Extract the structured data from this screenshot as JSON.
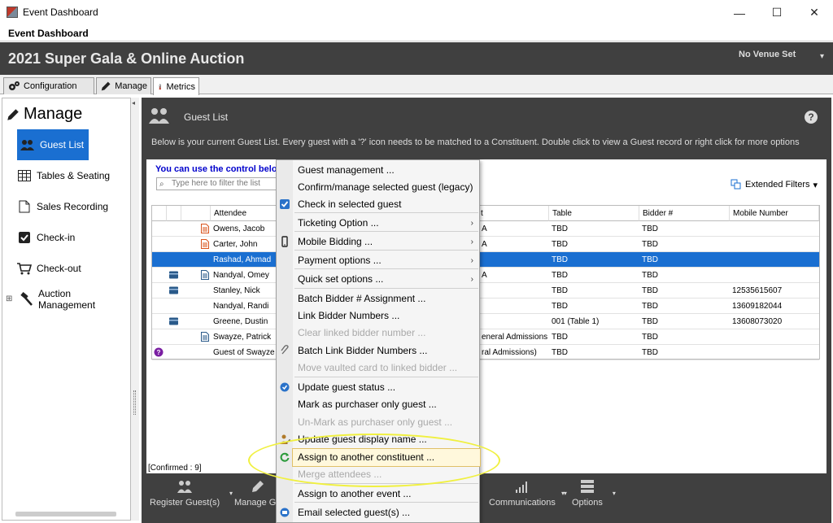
{
  "window": {
    "title": "Event Dashboard",
    "minimize": "—",
    "maximize": "☐",
    "close": "✕"
  },
  "app_header": "Event Dashboard",
  "banner": {
    "event_title": "2021 Super Gala & Online Auction",
    "venue": "No Venue Set"
  },
  "tabs": [
    {
      "label": "Configuration"
    },
    {
      "label": "Manage"
    },
    {
      "label": "Metrics"
    }
  ],
  "sidebar": {
    "heading": "Manage",
    "items": [
      {
        "label": "Guest List"
      },
      {
        "label": "Tables & Seating"
      },
      {
        "label": "Sales Recording"
      },
      {
        "label": "Check-in"
      },
      {
        "label": "Check-out"
      },
      {
        "label": "Auction Management"
      }
    ],
    "expand": "⊞"
  },
  "main": {
    "title": "Guest List",
    "help": "?",
    "description": "Below is your current Guest List. Every guest with a '?' icon needs to be matched to a Constituent. Double click to view a Guest record or right click for more options",
    "control_hint": "You can use the control belo",
    "filter_placeholder": "Type here to filter the list",
    "extended_filters": "Extended Filters",
    "confirmed": "[Confirmed : 9]"
  },
  "grid": {
    "headers": [
      "Attendee",
      "t",
      "Table",
      "Bidder #",
      "Mobile Number"
    ],
    "rows": [
      {
        "attendee": "Owens, Jacob",
        "ticket": "A",
        "table": "TBD",
        "bidder": "TBD",
        "mobile": ""
      },
      {
        "attendee": "Carter, John",
        "ticket": "A",
        "table": "TBD",
        "bidder": "TBD",
        "mobile": ""
      },
      {
        "attendee": "Rashad, Ahmad",
        "ticket": "",
        "table": "TBD",
        "bidder": "TBD",
        "mobile": ""
      },
      {
        "attendee": "Nandyal, Omey",
        "ticket": "A",
        "table": "TBD",
        "bidder": "TBD",
        "mobile": ""
      },
      {
        "attendee": "Stanley, Nick",
        "ticket": "",
        "table": "TBD",
        "bidder": "TBD",
        "mobile": "12535615607"
      },
      {
        "attendee": "Nandyal, Randi",
        "ticket": "",
        "table": "TBD",
        "bidder": "TBD",
        "mobile": "13609182044"
      },
      {
        "attendee": "Greene, Dustin",
        "ticket": "",
        "table": "001 (Table 1)",
        "bidder": "TBD",
        "mobile": "13608073020"
      },
      {
        "attendee": "Swayze, Patrick",
        "ticket": "eneral Admissions",
        "table": "TBD",
        "bidder": "TBD",
        "mobile": ""
      },
      {
        "attendee": "Guest of Swayze",
        "ticket": "ral Admissions)",
        "table": "TBD",
        "bidder": "TBD",
        "mobile": ""
      }
    ]
  },
  "toolbar": {
    "register": "Register Guest(s)",
    "manage": "Manage Gu",
    "communications": "Communications",
    "options": "Options"
  },
  "context_menu": {
    "items": [
      {
        "label": "Guest management ...",
        "disabled": false
      },
      {
        "label": "Confirm/manage selected guest (legacy)",
        "disabled": false
      },
      {
        "label": "Check in selected guest",
        "disabled": false
      },
      {
        "label": "Ticketing Option ...",
        "disabled": false
      },
      {
        "label": "Mobile Bidding ...",
        "disabled": false
      },
      {
        "label": "Payment options ...",
        "disabled": false
      },
      {
        "label": "Quick set options ...",
        "disabled": false
      },
      {
        "label": "Batch Bidder # Assignment ...",
        "disabled": false
      },
      {
        "label": "Link Bidder Numbers ...",
        "disabled": false
      },
      {
        "label": "Clear linked bidder number ...",
        "disabled": true
      },
      {
        "label": "Batch Link Bidder Numbers ...",
        "disabled": false
      },
      {
        "label": "Move vaulted card to linked bidder ...",
        "disabled": true
      },
      {
        "label": "Update guest status ...",
        "disabled": false
      },
      {
        "label": "Mark as purchaser only guest ...",
        "disabled": false
      },
      {
        "label": "Un-Mark as purchaser only guest ...",
        "disabled": true
      },
      {
        "label": "Update guest display name ...",
        "disabled": false
      },
      {
        "label": "Assign to another constituent ...",
        "disabled": false
      },
      {
        "label": "Merge attendees ...",
        "disabled": true
      },
      {
        "label": "Assign to another event ...",
        "disabled": false
      },
      {
        "label": "Email selected guest(s) ...",
        "disabled": false
      }
    ],
    "submenu_arrow": "›"
  },
  "icons": {
    "search": "⌕",
    "chevron_down": "▾",
    "collapse": "◂"
  }
}
